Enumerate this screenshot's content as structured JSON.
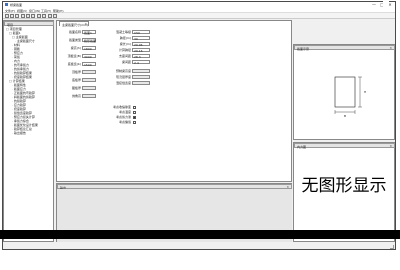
{
  "app": {
    "title": "桥梁截面",
    "minimize": "—",
    "maximize": "□",
    "close": "✕"
  },
  "menu": [
    "文件(F)",
    "视图(V)",
    "窗口(W)",
    "工具(T)",
    "帮助(H)"
  ],
  "toolbar": {
    "buttons": [
      "new-icon",
      "open-icon",
      "save-icon",
      "cut-icon",
      "copy-icon",
      "paste-icon",
      "undo-icon",
      "redo-icon",
      "zoom-icon",
      "help-icon"
    ]
  },
  "left_panel": {
    "title": "项目",
    "tree": [
      {
        "label": "□ 项目管理",
        "level": 0
      },
      {
        "label": "□ 截面1",
        "level": 1
      },
      {
        "label": "□ 主梁截面",
        "level": 2
      },
      {
        "label": "· 主梁截面尺寸",
        "level": 3
      },
      {
        "label": "· 材料",
        "level": 2
      },
      {
        "label": "· 钢筋",
        "level": 2
      },
      {
        "label": "· 预应力",
        "level": 2
      },
      {
        "label": "· 荷载",
        "level": 2
      },
      {
        "label": "· 内力",
        "level": 2
      },
      {
        "label": "· 抗弯承载力",
        "level": 2
      },
      {
        "label": "· 抗剪承载力",
        "level": 2
      },
      {
        "label": "· 抗裂验算结果",
        "level": 2
      },
      {
        "label": "· 挠度验算结果",
        "level": 2
      },
      {
        "label": "□ 计算结果",
        "level": 1
      },
      {
        "label": "· 截面特性",
        "level": 2
      },
      {
        "label": "· 截面应力",
        "level": 2
      },
      {
        "label": "· 正截面抗弯验算",
        "level": 2
      },
      {
        "label": "· 斜截面抗剪验算",
        "level": 2
      },
      {
        "label": "· 抗裂验算",
        "level": 2
      },
      {
        "label": "· 应力验算",
        "level": 2
      },
      {
        "label": "· 挠度验算",
        "level": 2
      },
      {
        "label": "· 裂缝宽度验算",
        "level": 2
      },
      {
        "label": "· 预应力损失计算",
        "level": 2
      },
      {
        "label": "· 承载力综合",
        "level": 2
      },
      {
        "label": "· 截面优化设计结果",
        "level": 2
      },
      {
        "label": "· 验算结论汇总",
        "level": 2
      },
      {
        "label": "· 输出报告",
        "level": 2
      }
    ]
  },
  "center_panel": {
    "tab_label": "主梁截面尺寸(mm)",
    "tab_close": "✕",
    "left_fields": [
      {
        "label": "截面名称",
        "value": "截面1",
        "readonly": false
      },
      {
        "label": "截面类型",
        "value": "箱形截面",
        "readonly": false
      },
      {
        "label": "梁高(h)",
        "value": "1800",
        "readonly": false
      },
      {
        "label": "顶板宽(B)",
        "value": "3000",
        "readonly": false
      },
      {
        "label": "底板宽(b)",
        "value": "1500",
        "readonly": false
      },
      {
        "label": "顶板厚",
        "value": "",
        "readonly": true
      },
      {
        "label": "底板厚",
        "value": "",
        "readonly": true
      },
      {
        "label": "腹板厚",
        "value": "",
        "readonly": true
      },
      {
        "label": "倒角高",
        "value": "",
        "readonly": true
      }
    ],
    "right_fields": [
      {
        "label": "混凝土等级",
        "value": "C50",
        "readonly": false
      },
      {
        "label": "跨径(m)",
        "value": "30",
        "readonly": false
      },
      {
        "label": "梁长(m)",
        "value": "29.96",
        "readonly": false
      },
      {
        "label": "计算跨径",
        "value": "29.16",
        "readonly": false
      },
      {
        "label": "支座间距",
        "value": "28.3",
        "readonly": false
      },
      {
        "label": "梁间距",
        "value": "2.4",
        "readonly": false
      }
    ],
    "right_fields2": [
      {
        "label": "预制梁高度",
        "value": "",
        "readonly": true
      },
      {
        "label": "现浇层厚度",
        "value": "",
        "readonly": true
      },
      {
        "label": "湿接缝宽度",
        "value": "",
        "readonly": true
      }
    ],
    "checkboxes": [
      {
        "label": "考虑收缩徐变",
        "checked": false
      },
      {
        "label": "考虑温度",
        "checked": false
      },
      {
        "label": "考虑剪力滞",
        "checked": true
      },
      {
        "label": "考虑偏载",
        "checked": false
      }
    ]
  },
  "bottom_panel": {
    "title": "输出",
    "close": "✕"
  },
  "preview_panel": {
    "title": "截面示意",
    "close": "✕",
    "dim_width": "B",
    "dim_height": "H"
  },
  "nograph_panel": {
    "title": "内力图",
    "close": "✕",
    "message": "无图形显示"
  }
}
